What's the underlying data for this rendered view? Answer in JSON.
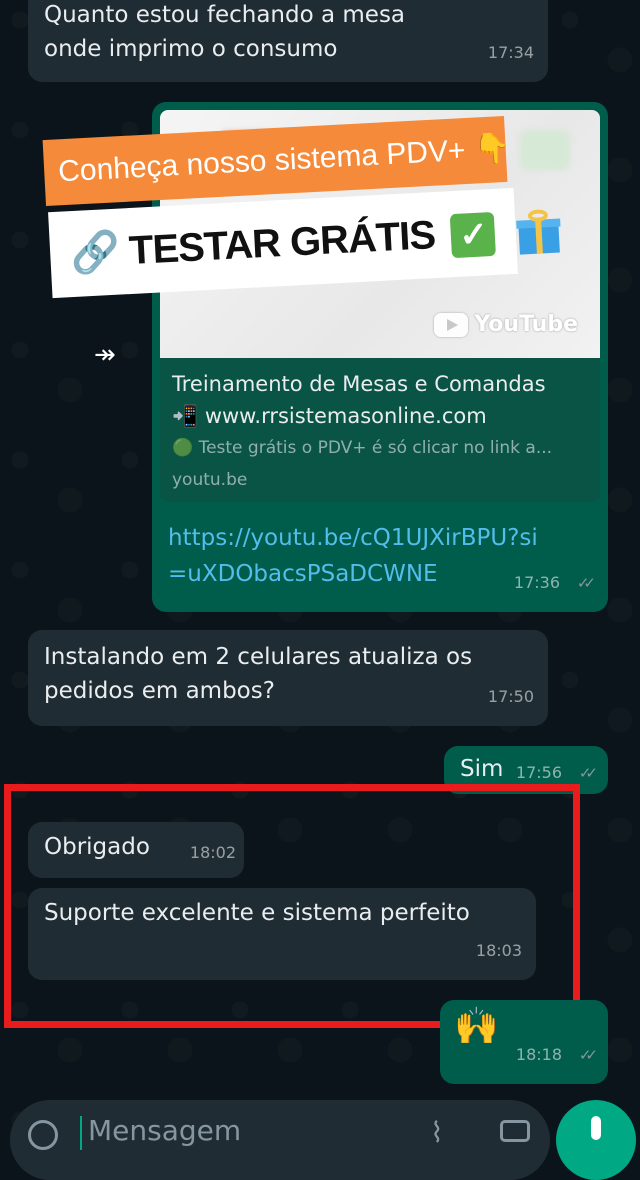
{
  "messages": {
    "m1": {
      "line1": "Quanto estou fechando a mesa",
      "line2": "onde imprimo o consumo",
      "time": "17:34"
    },
    "m2": {
      "preview_title": "Treinamento de Mesas e Comandas",
      "preview_site": "📲 www.rrsistemasonline.com",
      "preview_desc": "🟢 Teste grátis o PDV+ é só clicar no link a...",
      "preview_domain": "youtu.be",
      "youtube_label": "YouTube",
      "link_line1": "https://youtu.be/cQ1UJXirBPU?si",
      "link_line2": "=uXDObacsPSaDCWNE",
      "time": "17:36"
    },
    "m3": {
      "line1": "Instalando em 2 celulares atualiza os",
      "line2": "pedidos em ambos?",
      "time": "17:50"
    },
    "m4": {
      "text": "Sim",
      "time": "17:56"
    },
    "m5": {
      "text": "Obrigado",
      "time": "18:02"
    },
    "m6": {
      "text": "Suporte excelente e sistema perfeito",
      "time": "18:03"
    },
    "m7": {
      "emoji": "🙌",
      "time": "18:18"
    }
  },
  "overlay": {
    "promo_line": "Conheça nosso sistema PDV+ 👇",
    "cta_line": "🔗 TESTAR GRÁTIS"
  },
  "composer": {
    "placeholder": "Mensagem"
  },
  "colors": {
    "incoming": "#202c33",
    "outgoing": "#005c4b",
    "highlight": "#e81c1c",
    "accent": "#00a884"
  }
}
